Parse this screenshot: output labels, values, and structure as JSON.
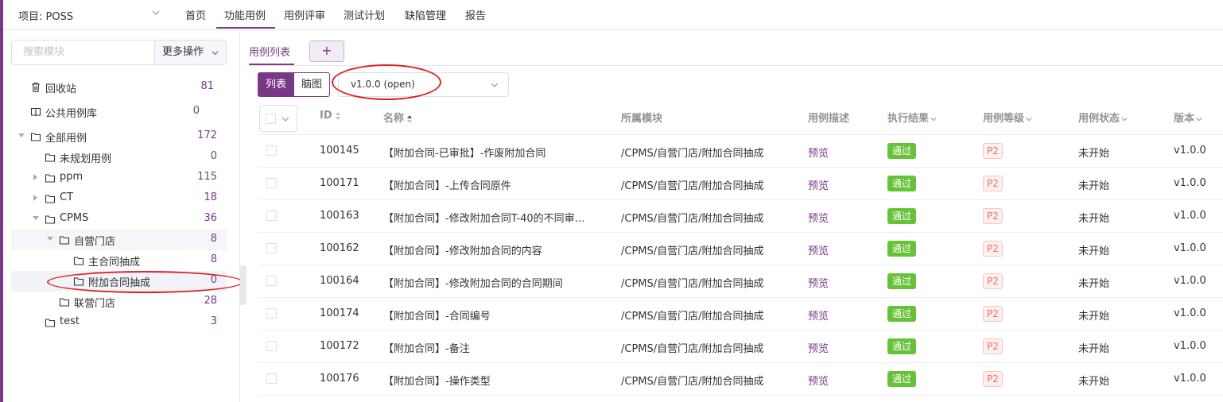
{
  "topnav": {
    "project_label": "项目: POSS",
    "items": [
      {
        "label": "首页"
      },
      {
        "label": "功能用例"
      },
      {
        "label": "用例评审"
      },
      {
        "label": "测试计划"
      },
      {
        "label": "缺陷管理"
      },
      {
        "label": "报告"
      }
    ],
    "active": "功能用例"
  },
  "sidebar": {
    "search_placeholder": "搜索模块",
    "more_actions": "更多操作",
    "tree": [
      {
        "label": "回收站",
        "count": "81",
        "icon": "trash-icon"
      },
      {
        "label": "公共用例库",
        "count": "0",
        "icon": "book-icon"
      },
      {
        "label": "全部用例",
        "count": "172",
        "icon": "folder-icon",
        "expanded": true
      },
      {
        "label": "未规划用例",
        "count": "0",
        "icon": "folder-icon"
      },
      {
        "label": "ppm",
        "count": "115",
        "icon": "folder-icon",
        "expanded": false
      },
      {
        "label": "CT",
        "count": "18",
        "icon": "folder-icon",
        "expanded": false
      },
      {
        "label": "CPMS",
        "count": "36",
        "icon": "folder-icon",
        "expanded": true
      },
      {
        "label": "自营门店",
        "count": "8",
        "icon": "folder-icon",
        "expanded": true
      },
      {
        "label": "主合同抽成",
        "count": "8",
        "icon": "folder-icon"
      },
      {
        "label": "附加合同抽成",
        "count": "0",
        "icon": "folder-icon",
        "selected": true
      },
      {
        "label": "联营门店",
        "count": "28",
        "icon": "folder-icon"
      },
      {
        "label": "test",
        "count": "3",
        "icon": "folder-icon"
      }
    ]
  },
  "main": {
    "tab_label": "用例列表",
    "tab_add": "+",
    "view_list": "列表",
    "view_mind": "脑图",
    "version_value": "v1.0.0 (open)",
    "columns": [
      "ID",
      "名称",
      "所属模块",
      "用例描述",
      "执行结果",
      "用例等级",
      "用例状态",
      "版本"
    ],
    "rows": [
      {
        "id": "100145",
        "name": "【附加合同-已审批】-作废附加合同",
        "module": "/CPMS/自营门店/附加合同抽成",
        "desc": "预览",
        "result": "通过",
        "level": "P2",
        "status": "未开始",
        "version": "v1.0.0"
      },
      {
        "id": "100171",
        "name": "【附加合同】-上传合同原件",
        "module": "/CPMS/自营门店/附加合同抽成",
        "desc": "预览",
        "result": "通过",
        "level": "P2",
        "status": "未开始",
        "version": "v1.0.0"
      },
      {
        "id": "100163",
        "name": "【附加合同】-修改附加合同T-40的不同审…",
        "module": "/CPMS/自营门店/附加合同抽成",
        "desc": "预览",
        "result": "通过",
        "level": "P2",
        "status": "未开始",
        "version": "v1.0.0"
      },
      {
        "id": "100162",
        "name": "【附加合同】-修改附加合同的内容",
        "module": "/CPMS/自营门店/附加合同抽成",
        "desc": "预览",
        "result": "通过",
        "level": "P2",
        "status": "未开始",
        "version": "v1.0.0"
      },
      {
        "id": "100164",
        "name": "【附加合同】-修改附加合同的合同期间",
        "module": "/CPMS/自营门店/附加合同抽成",
        "desc": "预览",
        "result": "通过",
        "level": "P2",
        "status": "未开始",
        "version": "v1.0.0"
      },
      {
        "id": "100174",
        "name": "【附加合同】-合同编号",
        "module": "/CPMS/自营门店/附加合同抽成",
        "desc": "预览",
        "result": "通过",
        "level": "P2",
        "status": "未开始",
        "version": "v1.0.0"
      },
      {
        "id": "100172",
        "name": "【附加合同】-备注",
        "module": "/CPMS/自营门店/附加合同抽成",
        "desc": "预览",
        "result": "通过",
        "level": "P2",
        "status": "未开始",
        "version": "v1.0.0"
      },
      {
        "id": "100176",
        "name": "【附加合同】-操作类型",
        "module": "/CPMS/自营门店/附加合同抽成",
        "desc": "预览",
        "result": "通过",
        "level": "P2",
        "status": "未开始",
        "version": "v1.0.0"
      }
    ]
  },
  "colors": {
    "accent": "#783887",
    "pass": "#67c23a",
    "p2": "#f56c6c",
    "annotation": "#e02020"
  }
}
